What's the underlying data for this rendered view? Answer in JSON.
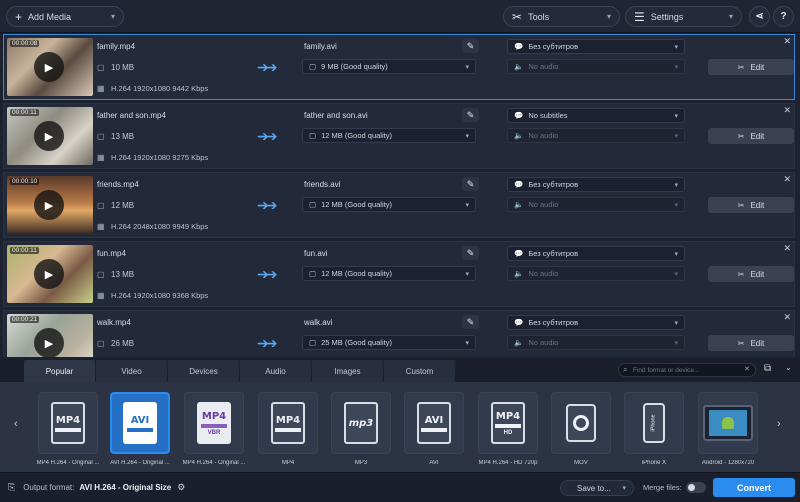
{
  "toolbar": {
    "add_media": "Add Media",
    "tools": "Tools",
    "settings": "Settings",
    "help": "?"
  },
  "files": [
    {
      "duration": "00:00:08",
      "name": "family.mp4",
      "size": "10 MB",
      "codec": "H.264 1920x1080 9442 Kbps",
      "output_name": "family.avi",
      "output_size": "9 MB (Good quality)",
      "subtitles": "Без субтитров",
      "audio": "No audio",
      "edit": "Edit",
      "selected": true
    },
    {
      "duration": "00:00:11",
      "name": "father and son.mp4",
      "size": "13 MB",
      "codec": "H.264 1920x1080 9275 Kbps",
      "output_name": "father and son.avi",
      "output_size": "12 MB (Good quality)",
      "subtitles": "No subtitles",
      "audio": "No audio",
      "edit": "Edit",
      "selected": false
    },
    {
      "duration": "00:00:10",
      "name": "friends.mp4",
      "size": "12 MB",
      "codec": "H.264 2048x1080 9949 Kbps",
      "output_name": "friends.avi",
      "output_size": "12 MB (Good quality)",
      "subtitles": "Без субтитров",
      "audio": "No audio",
      "edit": "Edit",
      "selected": false
    },
    {
      "duration": "00:00:11",
      "name": "fun.mp4",
      "size": "13 MB",
      "codec": "H.264 1920x1080 9368 Kbps",
      "output_name": "fun.avi",
      "output_size": "12 MB (Good quality)",
      "subtitles": "Без субтитров",
      "audio": "No audio",
      "edit": "Edit",
      "selected": false
    },
    {
      "duration": "00:00:21",
      "name": "walk.mp4",
      "size": "26 MB",
      "codec": "",
      "output_name": "walk.avi",
      "output_size": "25 MB (Good quality)",
      "subtitles": "Без субтитров",
      "audio": "No audio",
      "edit": "Edit",
      "selected": false
    }
  ],
  "tabs": [
    "Popular",
    "Video",
    "Devices",
    "Audio",
    "Images",
    "Custom"
  ],
  "search_placeholder": "Find format or device...",
  "formats": [
    {
      "label": "MP4 H.264 - Original ...",
      "big": "MP4",
      "sub": "",
      "style": "doc-dark"
    },
    {
      "label": "AVI H.264 - Original ...",
      "big": "AVI",
      "sub": "",
      "style": "doc-avi"
    },
    {
      "label": "MP4 H.264 - Original ...",
      "big": "MP4",
      "sub": "VBR",
      "style": "doc-vbr"
    },
    {
      "label": "MP4",
      "big": "MP4",
      "sub": "",
      "style": "doc-dark"
    },
    {
      "label": "MP3",
      "big": "mp3",
      "sub": "",
      "style": "doc-dark"
    },
    {
      "label": "AVI",
      "big": "AVI",
      "sub": "",
      "style": "doc-dark"
    },
    {
      "label": "MP4 H.264 - HD 720p",
      "big": "MP4",
      "sub": "HD",
      "style": "doc-dark"
    },
    {
      "label": "MOV",
      "big": "",
      "sub": "",
      "style": "qt"
    },
    {
      "label": "iPhone X",
      "big": "iPhone",
      "sub": "",
      "style": "phone"
    },
    {
      "label": "Android - 1280x720",
      "big": "",
      "sub": "",
      "style": "tablet"
    }
  ],
  "bottom": {
    "output_format_label": "Output format:",
    "output_format_value": "AVI H.264 - Original Size",
    "save_to": "Save to...",
    "merge_files": "Merge files:",
    "convert": "Convert"
  },
  "colors": {
    "accent": "#2b8cf0",
    "background": "#1c2230",
    "selected_border": "#3c88d8"
  }
}
